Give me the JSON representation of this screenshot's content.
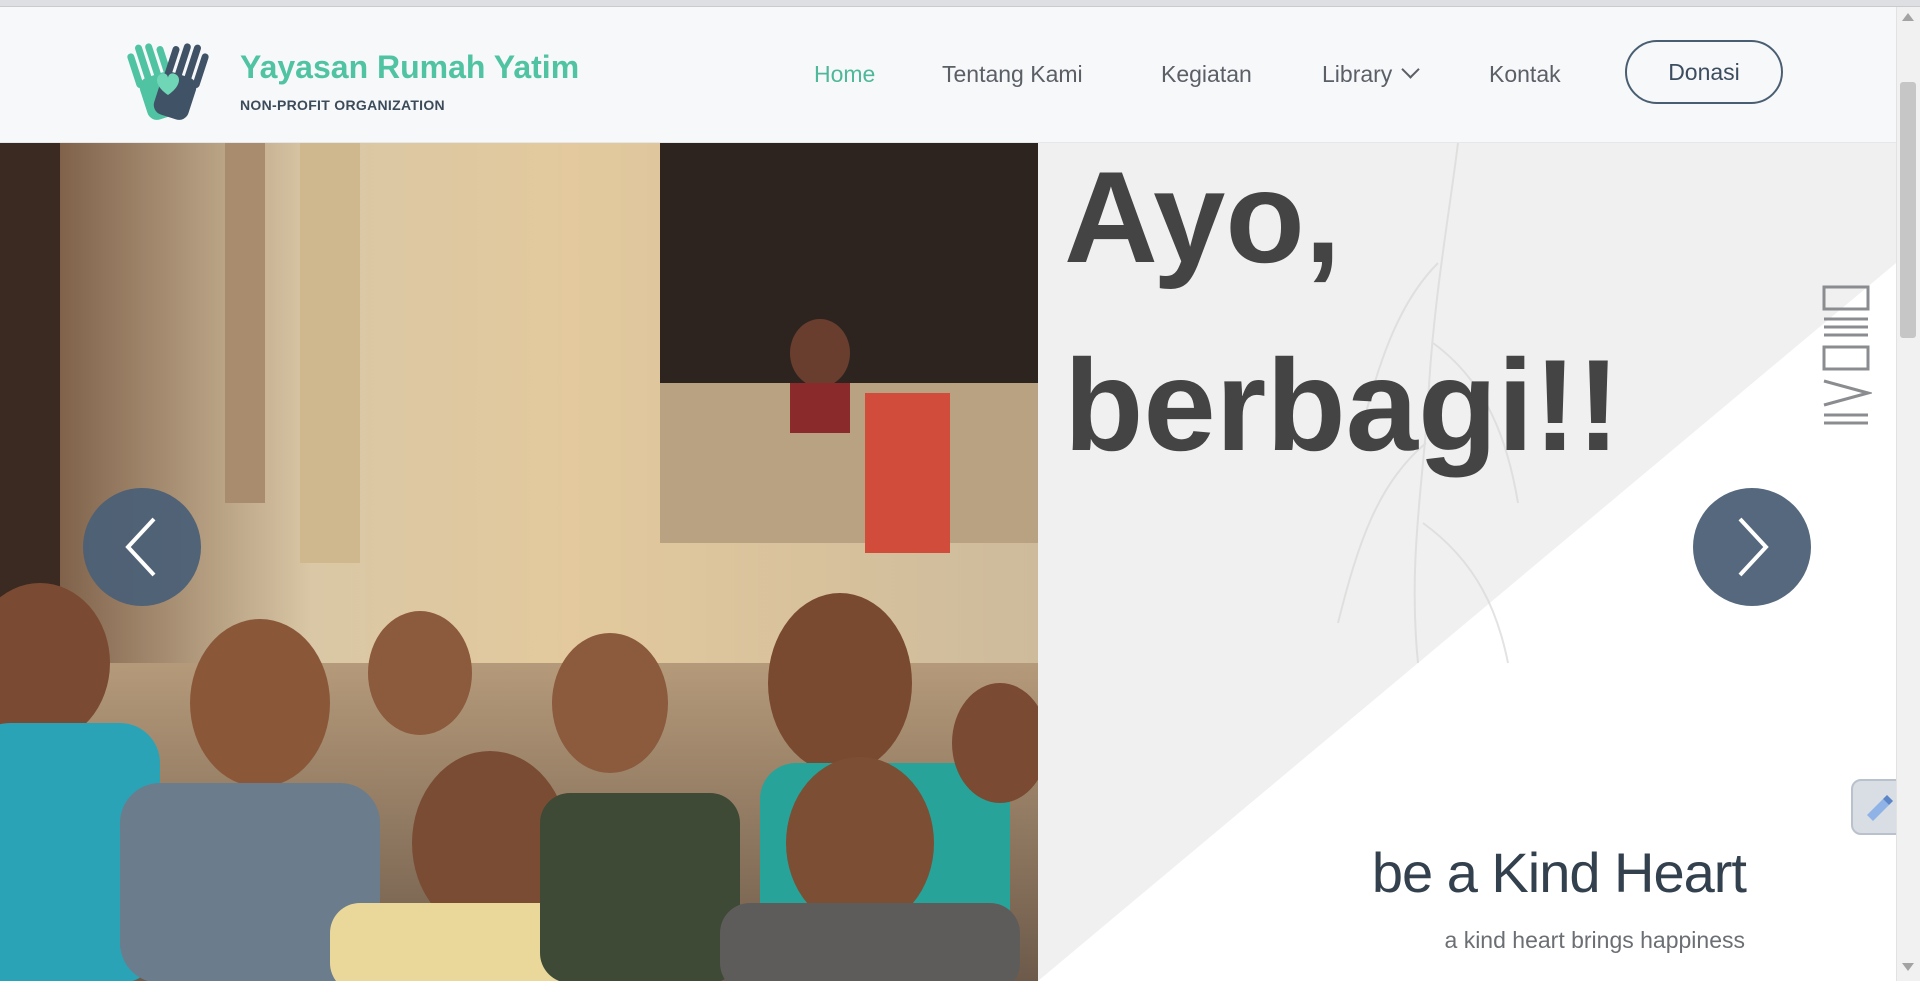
{
  "brand": {
    "name": "Yayasan Rumah Yatim",
    "tagline": "NON-PROFIT ORGANIZATION"
  },
  "nav": {
    "items": [
      {
        "label": "Home",
        "active": true
      },
      {
        "label": "Tentang Kami",
        "active": false
      },
      {
        "label": "Kegiatan",
        "active": false
      },
      {
        "label": "Library",
        "active": false,
        "has_dropdown": true
      },
      {
        "label": "Kontak",
        "active": false
      }
    ],
    "donate_label": "Donasi"
  },
  "hero": {
    "headline_line1": "Ayo,",
    "headline_line2": "berbagi!!",
    "title": "be a Kind Heart",
    "subtitle": "a kind heart brings happiness"
  },
  "colors": {
    "brand_green": "#4fc3a2",
    "nav_active": "#4fb89a",
    "slate": "#4a5e72",
    "headline": "#444444"
  },
  "icons": {
    "logo": "hands-heart-logo",
    "prev": "chevron-left-icon",
    "next": "chevron-right-icon",
    "dropdown": "chevron-down-icon",
    "floating": "pencil-icon"
  }
}
